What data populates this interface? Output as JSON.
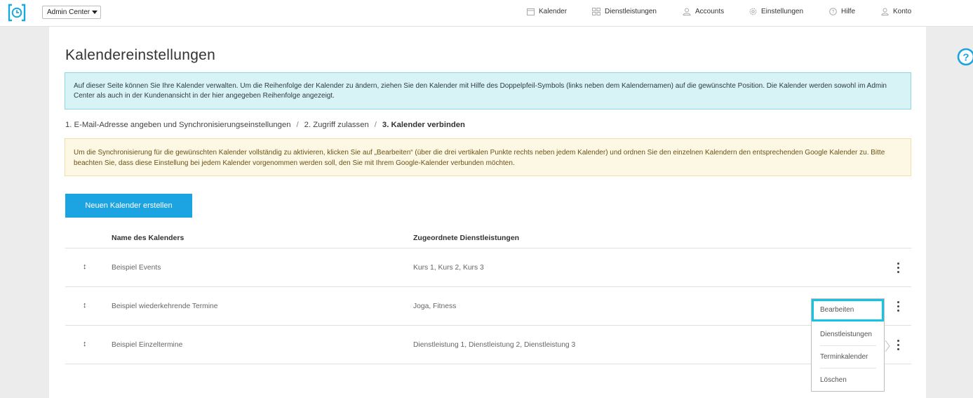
{
  "topbar": {
    "admin_select": "Admin Center",
    "nav": [
      {
        "label": "Kalender",
        "icon": "calendar-icon"
      },
      {
        "label": "Dienstleistungen",
        "icon": "grid-icon"
      },
      {
        "label": "Accounts",
        "icon": "users-icon"
      },
      {
        "label": "Einstellungen",
        "icon": "gear-icon"
      },
      {
        "label": "Hilfe",
        "icon": "help-icon"
      },
      {
        "label": "Konto",
        "icon": "user-icon"
      }
    ]
  },
  "page": {
    "title": "Kalendereinstellungen",
    "info_text": "Auf dieser Seite können Sie Ihre Kalender verwalten. Um die Reihenfolge der Kalender zu ändern, ziehen Sie den Kalender mit Hilfe des Doppelpfeil-Symbols (links neben dem Kalendernamen) auf die gewünschte Position. Die Kalender werden sowohl im Admin Center als auch in der Kundenansicht in der hier angegeben Reihenfolge angezeigt.",
    "breadcrumb": {
      "step1": "1. E-Mail-Adresse angeben und Synchronisierungseinstellungen",
      "step2": "2. Zugriff zulassen",
      "step3": "3. Kalender verbinden",
      "separator": "/"
    },
    "warning_text": "Um die Synchronisierung für die gewünschten Kalender vollständig zu aktivieren, klicken Sie auf „Bearbeiten“ (über die drei vertikalen Punkte rechts neben jedem Kalender) und ordnen Sie den einzelnen Kalendern den entsprechenden Google Kalender zu. Bitte beachten Sie, dass diese Einstellung bei jedem Kalender vorgenommen werden soll, den Sie mit Ihrem Google-Kalender verbunden möchten.",
    "create_button": "Neuen Kalender erstellen"
  },
  "table": {
    "headers": {
      "name": "Name des Kalenders",
      "services": "Zugeordnete Dienstleistungen"
    },
    "drag_glyph": "↕",
    "rows": [
      {
        "name": "Beispiel Events",
        "services": "Kurs 1, Kurs 2, Kurs 3"
      },
      {
        "name": "Beispiel wiederkehrende Termine",
        "services": "Joga, Fitness"
      },
      {
        "name": "Beispiel Einzeltermine",
        "services": "Dienstleistung 1, Dienstleistung 2, Dienstleistung 3"
      }
    ]
  },
  "menu": {
    "items": [
      "Bearbeiten",
      "Dienstleistungen",
      "Terminkalender",
      "Löschen"
    ],
    "highlight_color": "#13c4e3"
  },
  "colors": {
    "accent": "#1ca4e2",
    "info_bg": "#d8f3f6",
    "warning_bg": "#fdf8e4"
  }
}
